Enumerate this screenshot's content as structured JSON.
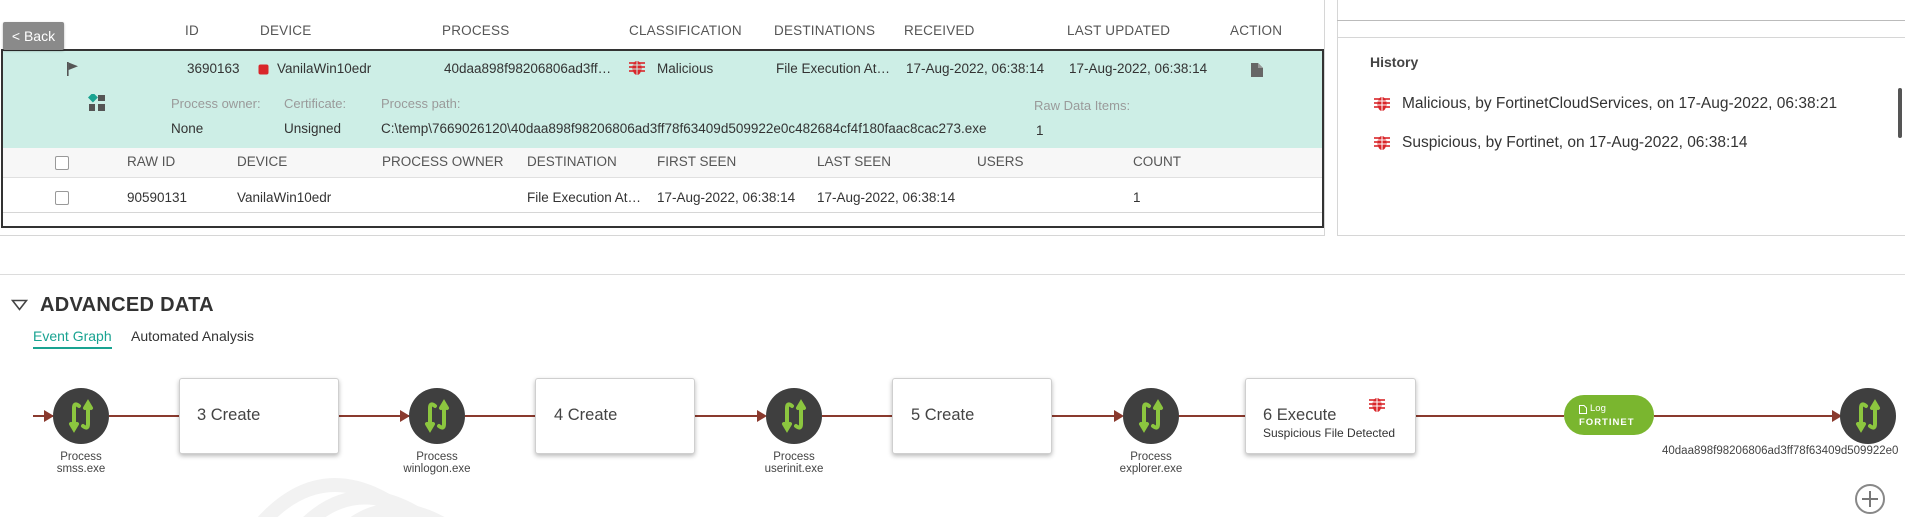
{
  "colors": {
    "accent": "#19a391",
    "malicious": "#d9262a",
    "row_highlight": "#cdeee6",
    "flow_line": "#8a3a2e",
    "log_green": "#7ab62f"
  },
  "back_label": "< Back",
  "table": {
    "headers": {
      "id": "ID",
      "device": "DEVICE",
      "process": "PROCESS",
      "classification": "CLASSIFICATION",
      "destinations": "DESTINATIONS",
      "received": "RECEIVED",
      "last_updated": "LAST UPDATED",
      "action": "ACTION"
    },
    "row": {
      "id": "3690163",
      "device": "VanilaWin10edr",
      "process": "40daa898f98206806ad3ff…",
      "classification": "Malicious",
      "destinations": "File Execution At…",
      "received": "17-Aug-2022, 06:38:14",
      "last_updated": "17-Aug-2022, 06:38:14"
    },
    "expanded": {
      "owner_label": "Process owner:",
      "owner_value": "None",
      "certificate_label": "Certificate:",
      "certificate_value": "Unsigned",
      "path_label": "Process path:",
      "path_value": "C:\\temp\\7669026120\\40daa898f98206806ad3ff78f63409d509922e0c482684cf4f180faac8cac273.exe",
      "raw_items_label": "Raw Data Items:",
      "raw_items_value": "1"
    },
    "sub_headers": {
      "raw_id": "RAW ID",
      "device": "DEVICE",
      "process_owner": "PROCESS OWNER",
      "destination": "DESTINATION",
      "first_seen": "FIRST SEEN",
      "last_seen": "LAST SEEN",
      "users": "USERS",
      "count": "COUNT"
    },
    "sub_row": {
      "raw_id": "90590131",
      "device": "VanilaWin10edr",
      "process_owner": "",
      "destination": "File Execution At…",
      "first_seen": "17-Aug-2022, 06:38:14",
      "last_seen": "17-Aug-2022, 06:38:14",
      "users": "",
      "count": "1"
    }
  },
  "history": {
    "title": "History",
    "items": [
      {
        "text": "Malicious, by FortinetCloudServices, on 17-Aug-2022, 06:38:21",
        "icon": "bug-icon"
      },
      {
        "text": "Suspicious, by Fortinet, on 17-Aug-2022, 06:38:14",
        "icon": "bug-icon"
      }
    ]
  },
  "advanced": {
    "title": "ADVANCED DATA",
    "tabs": [
      {
        "label": "Event Graph",
        "active": true
      },
      {
        "label": "Automated Analysis",
        "active": false
      }
    ]
  },
  "graph": {
    "nodes": [
      {
        "line1": "Process",
        "line2": "smss.exe"
      },
      {
        "line1": "Process",
        "line2": "winlogon.exe"
      },
      {
        "line1": "Process",
        "line2": "userinit.exe"
      },
      {
        "line1": "Process",
        "line2": "explorer.exe"
      },
      {
        "line1": "40daa898f98206806ad3ff78f63409d509922e0",
        "line2": ""
      }
    ],
    "cards": [
      {
        "title": "3 Create",
        "sub": ""
      },
      {
        "title": "4 Create",
        "sub": ""
      },
      {
        "title": "5 Create",
        "sub": ""
      },
      {
        "title": "6 Execute",
        "sub": "Suspicious File Detected"
      }
    ],
    "log_pill": {
      "label": "Log",
      "brand": "FORTINET"
    }
  }
}
